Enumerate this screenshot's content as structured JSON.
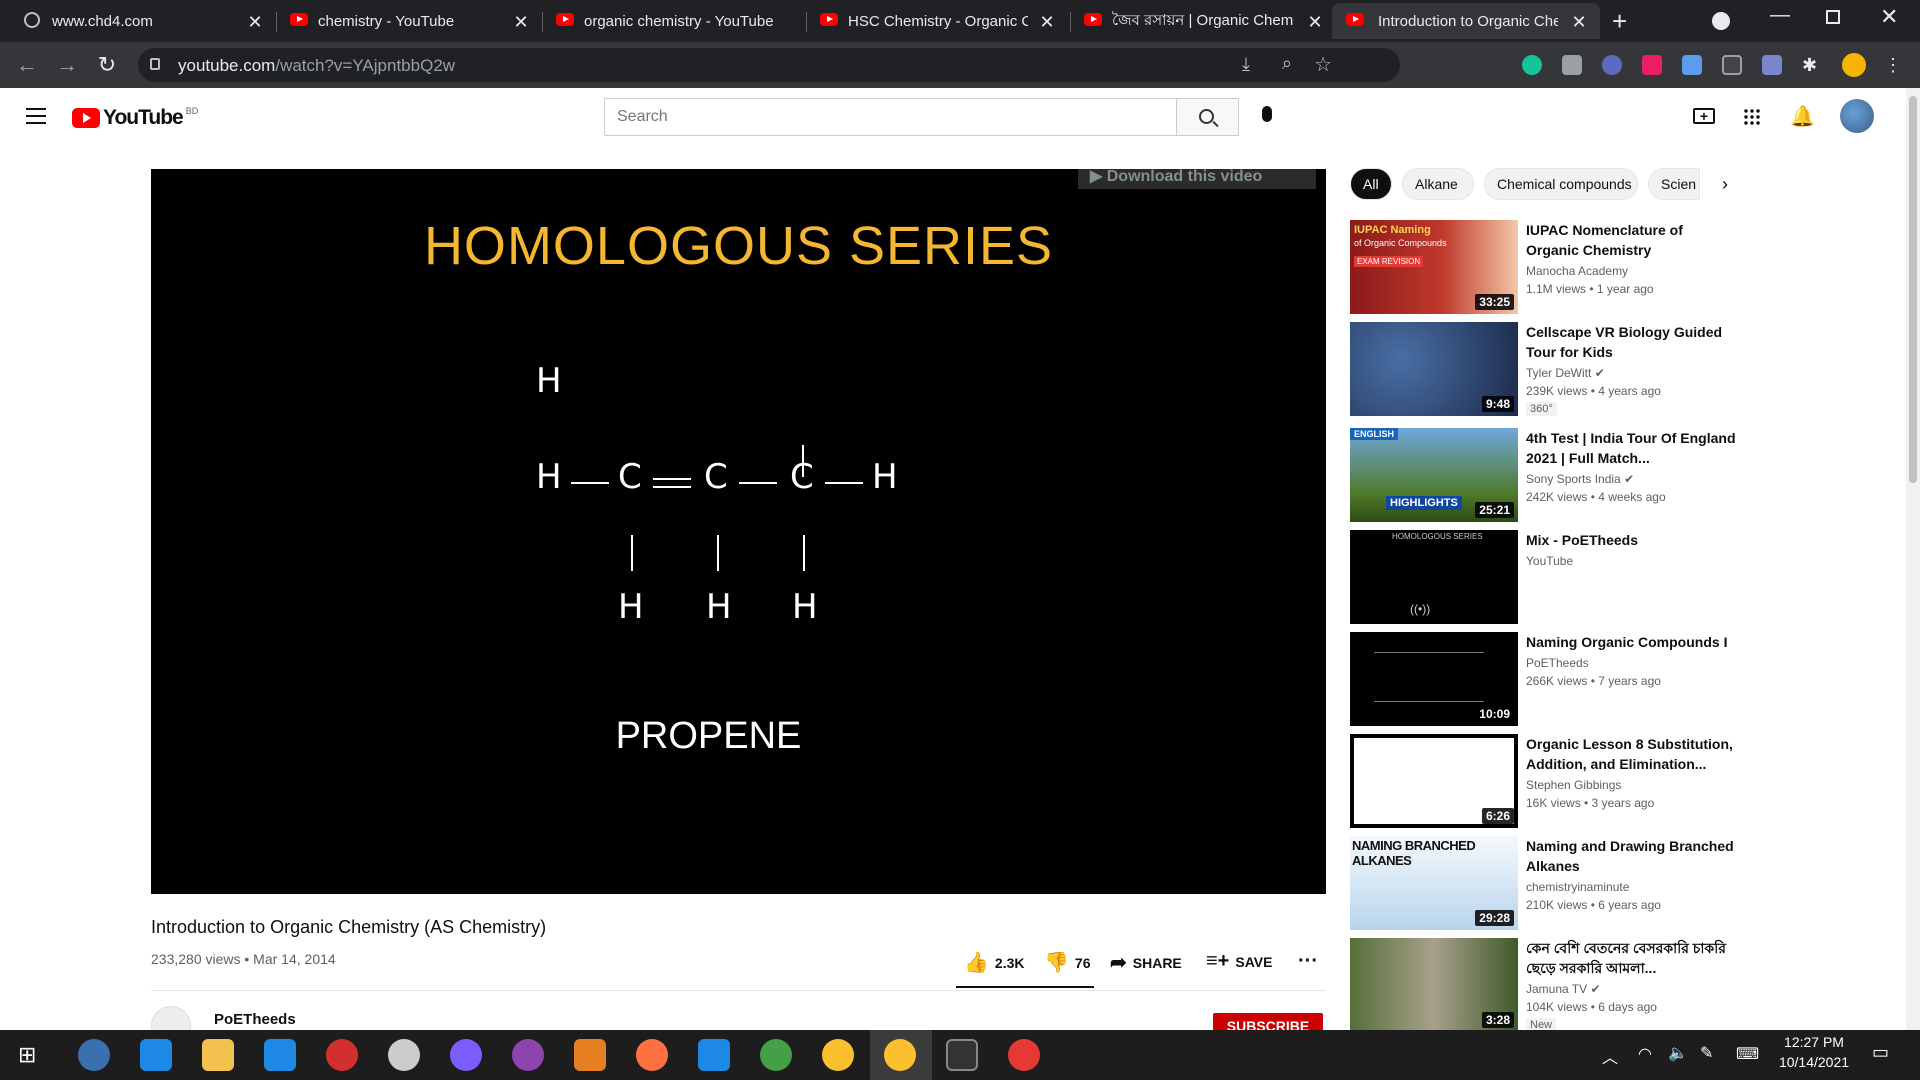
{
  "browser": {
    "tabs": [
      {
        "title": "www.chd4.com",
        "icon": "globe-icon"
      },
      {
        "title": "chemistry - YouTube",
        "icon": "youtube-icon"
      },
      {
        "title": "organic chemistry - YouTube",
        "icon": "youtube-icon"
      },
      {
        "title": "HSC Chemistry - Organic Ch",
        "icon": "youtube-icon"
      },
      {
        "title": "জৈব রসায়ন | Organic Chem",
        "icon": "youtube-icon"
      },
      {
        "title": "Introduction to Organic Che",
        "icon": "youtube-icon"
      }
    ],
    "url_host": "youtube.com",
    "url_path": "/watch?v=YAjpntbbQ2w"
  },
  "youtube": {
    "logo_text": "YouTube",
    "region": "BD",
    "search_placeholder": "Search"
  },
  "player": {
    "download_label": "▶ Download this video",
    "slide_title": "HOMOLOGOUS SERIES",
    "slide_caption": "PROPENE",
    "atom_h": "H",
    "atom_c": "C"
  },
  "video": {
    "title": "Introduction to Organic Chemistry (AS Chemistry)",
    "meta": "233,280 views • Mar 14, 2014",
    "likes": "2.3K",
    "dislikes": "76",
    "share_label": "SHARE",
    "save_label": "SAVE",
    "channel": "PoETheeds",
    "subscribe_label": "SUBSCRIBE"
  },
  "chips": [
    "All",
    "Alkane",
    "Chemical compounds",
    "Scien"
  ],
  "recommendations": [
    {
      "title": "IUPAC Nomenclature of Organic Chemistry",
      "channel": "Manocha Academy",
      "views": "1.1M views • 1 year ago",
      "duration": "33:25",
      "thumb_color": "#c0392b"
    },
    {
      "title": "Cellscape VR Biology Guided Tour for Kids",
      "channel": "Tyler DeWitt",
      "views": "239K views • 4 years ago",
      "duration": "9:48",
      "badge": "360°",
      "thumb_color": "#2c3e63"
    },
    {
      "title": "4th Test | India Tour Of England 2021 | Full Match...",
      "channel": "Sony Sports India",
      "views": "242K views • 4 weeks ago",
      "duration": "25:21",
      "thumb_color": "#5a8a3a"
    },
    {
      "title": "Mix - PoETheeds",
      "channel": "YouTube",
      "views": "",
      "duration": "",
      "thumb_color": "#000000"
    },
    {
      "title": "Naming Organic Compounds I",
      "channel": "PoETheeds",
      "views": "266K views • 7 years ago",
      "duration": "10:09",
      "thumb_color": "#000000"
    },
    {
      "title": "Organic Lesson 8 Substitution, Addition, and Elimination...",
      "channel": "Stephen Gibbings",
      "views": "16K views • 3 years ago",
      "duration": "6:26",
      "thumb_color": "#ffffff"
    },
    {
      "title": "Naming and Drawing Branched Alkanes",
      "channel": "chemistryinaminute",
      "views": "210K views • 6 years ago",
      "duration": "29:28",
      "thumb_color": "#dfe9f3"
    },
    {
      "title": "কেন বেশি বেতনের বেসরকারি চাকরি ছেড়ে সরকারি আমলা...",
      "channel": "Jamuna TV",
      "views": "104K views • 6 days ago",
      "duration": "3:28",
      "badge": "New",
      "thumb_color": "#6b7d4a"
    }
  ],
  "taskbar": {
    "time": "12:27 PM",
    "date": "10/14/2021"
  },
  "colors": {
    "youtube_red": "#ff0000",
    "chrome_dark": "#202124",
    "slide_title": "#f5b731"
  }
}
